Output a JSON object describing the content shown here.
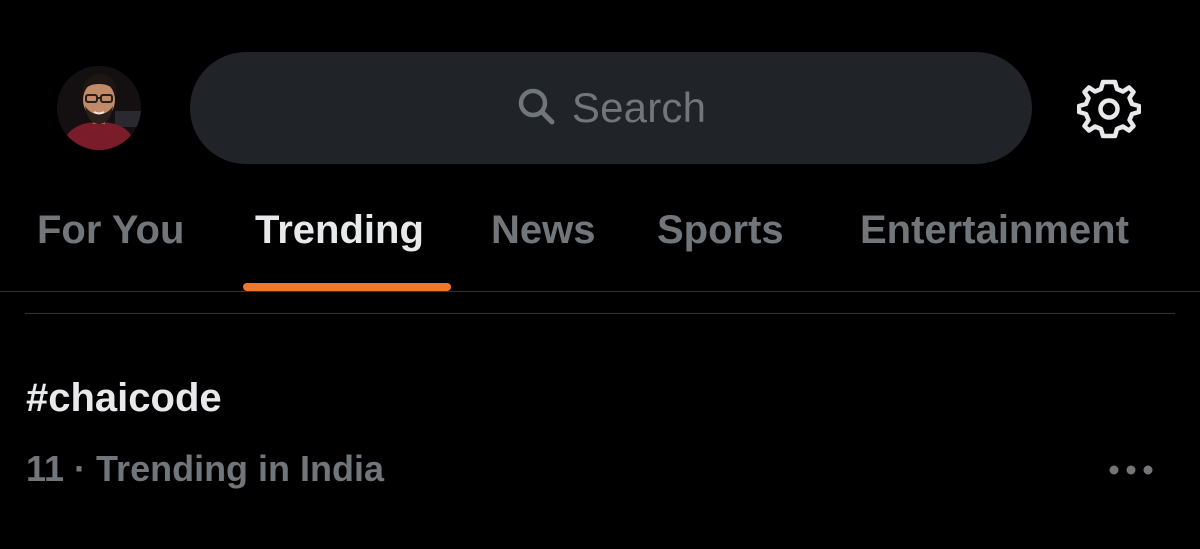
{
  "header": {
    "avatar_alt": "profile avatar",
    "search": {
      "placeholder": "Search",
      "icon": "search-icon"
    },
    "settings_icon": "gear-icon"
  },
  "tabs": [
    {
      "label": "For You",
      "active": false
    },
    {
      "label": "Trending",
      "active": true
    },
    {
      "label": "News",
      "active": false
    },
    {
      "label": "Sports",
      "active": false
    },
    {
      "label": "Entertainment",
      "active": false
    }
  ],
  "colors": {
    "background": "#000000",
    "accent": "#f0782d",
    "muted_text": "#71767b",
    "primary_text": "#e7e9ea",
    "search_bg": "#202327"
  },
  "trends": [
    {
      "title": "#chaicode",
      "meta": "11 · Trending in India",
      "more_icon": "more-horizontal-icon"
    }
  ]
}
